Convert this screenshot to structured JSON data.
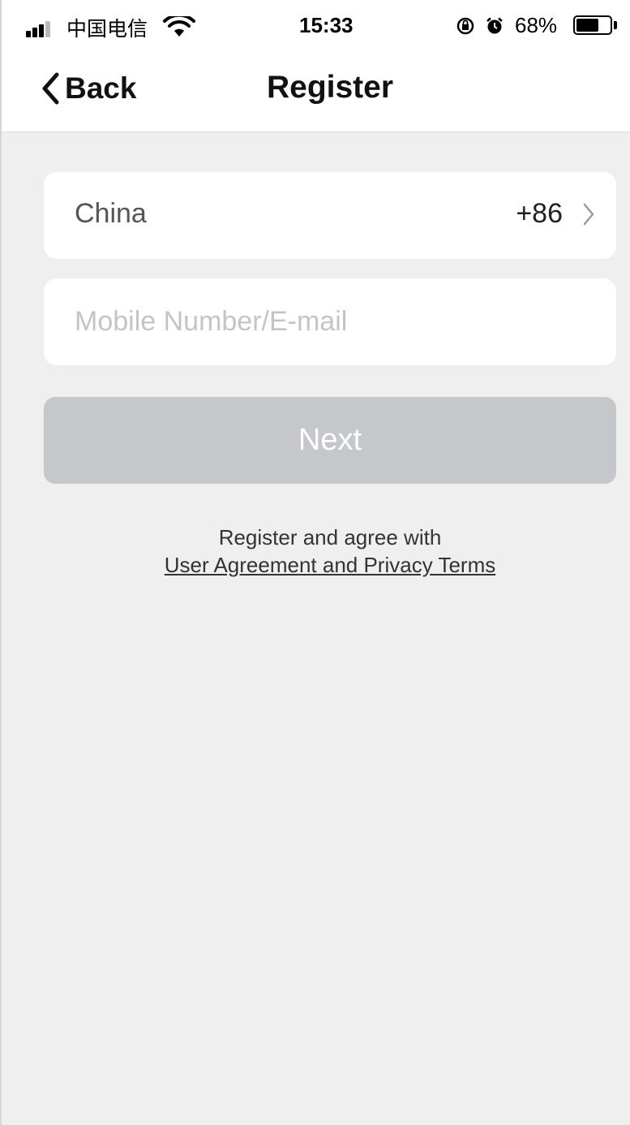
{
  "status_bar": {
    "carrier": "中国电信",
    "time": "15:33",
    "battery_percent": "68%",
    "battery_level": 0.68,
    "icons": [
      "signal-icon",
      "wifi-icon",
      "orientation-lock-icon",
      "alarm-icon",
      "battery-icon"
    ]
  },
  "nav": {
    "back_label": "Back",
    "title": "Register"
  },
  "form": {
    "country_name": "China",
    "country_code": "+86",
    "mobile_value": "",
    "mobile_placeholder": "Mobile Number/E-mail",
    "next_label": "Next"
  },
  "agreement": {
    "text": "Register and agree with",
    "link": "User Agreement and Privacy Terms"
  },
  "colors": {
    "background": "#efeff0",
    "card": "#ffffff",
    "button_disabled": "#c6c7ca",
    "placeholder": "#c4c4c7"
  }
}
